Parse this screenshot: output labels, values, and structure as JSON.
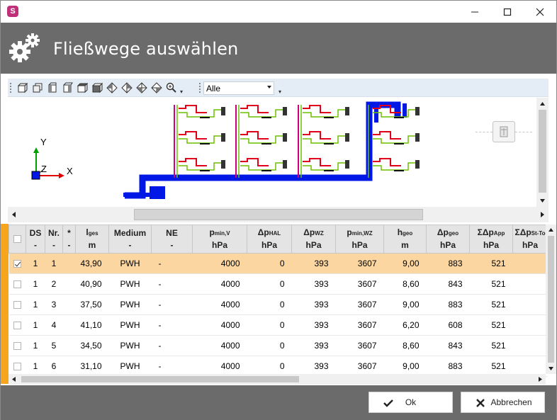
{
  "window": {
    "title": "Fließwege auswählen",
    "app_icon_letter": "S",
    "minimize_glyph": "—",
    "maximize_glyph": "☐",
    "close_glyph": "✕"
  },
  "toolbar": {
    "icons": [
      "view-front-icon",
      "view-back-icon",
      "view-left-icon",
      "view-right-icon",
      "view-top-icon",
      "view-bottom-icon",
      "view-iso-1-icon",
      "view-iso-2-icon",
      "view-iso-3-icon",
      "view-iso-4-icon",
      "zoom-icon"
    ],
    "filter_value": "Alle"
  },
  "axes": {
    "y": "Y",
    "x": "X",
    "z": "Z"
  },
  "grid": {
    "columns": [
      {
        "key": "check",
        "label": "",
        "unit": ""
      },
      {
        "key": "ds",
        "label": "DS",
        "unit": "-"
      },
      {
        "key": "nr",
        "label": "Nr.",
        "unit": "-"
      },
      {
        "key": "star",
        "label": "*",
        "unit": "-"
      },
      {
        "key": "lges",
        "label": "l",
        "sub": "ges",
        "unit": "m"
      },
      {
        "key": "medium",
        "label": "Medium",
        "unit": "-"
      },
      {
        "key": "ne",
        "label": "NE",
        "unit": "-"
      },
      {
        "key": "pminv",
        "label": "p",
        "sub": "min,V",
        "unit": "hPa"
      },
      {
        "key": "dphal",
        "label": "Δp",
        "sub": "HAL",
        "unit": "hPa"
      },
      {
        "key": "dpwz",
        "label": "Δp",
        "sub": "WZ",
        "unit": "hPa"
      },
      {
        "key": "pminwz",
        "label": "p",
        "sub": "min,WZ",
        "unit": "hPa"
      },
      {
        "key": "hgeo",
        "label": "h",
        "sub": "geo",
        "unit": "m"
      },
      {
        "key": "dpgeo",
        "label": "Δp",
        "sub": "geo",
        "unit": "hPa"
      },
      {
        "key": "sdpapp",
        "label": "ΣΔp",
        "sub": "App",
        "unit": "hPa"
      },
      {
        "key": "sdpst",
        "label": "ΣΔp",
        "sub": "St-To",
        "unit": "hPa"
      }
    ],
    "rows": [
      {
        "checked": true,
        "ds": "1",
        "nr": "1",
        "star": "",
        "lges": "43,90",
        "medium": "PWH",
        "ne": "-",
        "pminv": "4000",
        "dphal": "0",
        "dpwz": "393",
        "pminwz": "3607",
        "hgeo": "9,00",
        "dpgeo": "883",
        "sdpapp": "521",
        "sdpst": ""
      },
      {
        "checked": false,
        "ds": "1",
        "nr": "2",
        "star": "",
        "lges": "40,90",
        "medium": "PWH",
        "ne": "-",
        "pminv": "4000",
        "dphal": "0",
        "dpwz": "393",
        "pminwz": "3607",
        "hgeo": "8,60",
        "dpgeo": "843",
        "sdpapp": "521",
        "sdpst": ""
      },
      {
        "checked": false,
        "ds": "1",
        "nr": "3",
        "star": "",
        "lges": "37,50",
        "medium": "PWH",
        "ne": "-",
        "pminv": "4000",
        "dphal": "0",
        "dpwz": "393",
        "pminwz": "3607",
        "hgeo": "9,00",
        "dpgeo": "883",
        "sdpapp": "521",
        "sdpst": ""
      },
      {
        "checked": false,
        "ds": "1",
        "nr": "4",
        "star": "",
        "lges": "41,10",
        "medium": "PWH",
        "ne": "-",
        "pminv": "4000",
        "dphal": "0",
        "dpwz": "393",
        "pminwz": "3607",
        "hgeo": "6,20",
        "dpgeo": "608",
        "sdpapp": "521",
        "sdpst": ""
      },
      {
        "checked": false,
        "ds": "1",
        "nr": "5",
        "star": "",
        "lges": "34,50",
        "medium": "PWH",
        "ne": "-",
        "pminv": "4000",
        "dphal": "0",
        "dpwz": "393",
        "pminwz": "3607",
        "hgeo": "8,60",
        "dpgeo": "843",
        "sdpapp": "521",
        "sdpst": ""
      },
      {
        "checked": false,
        "ds": "1",
        "nr": "6",
        "star": "",
        "lges": "31,10",
        "medium": "PWH",
        "ne": "-",
        "pminv": "4000",
        "dphal": "0",
        "dpwz": "393",
        "pminwz": "3607",
        "hgeo": "9,00",
        "dpgeo": "883",
        "sdpapp": "521",
        "sdpst": ""
      }
    ]
  },
  "footer": {
    "ok_label": "Ok",
    "cancel_label": "Abbrechen"
  },
  "colors": {
    "header_bg": "#6b6b6b",
    "selected_row": "#fbd6a1",
    "accent_orange": "#f7a51c",
    "pipe_blue": "#0018e6",
    "pipe_red": "#e0001a",
    "pipe_green": "#6cc000"
  }
}
